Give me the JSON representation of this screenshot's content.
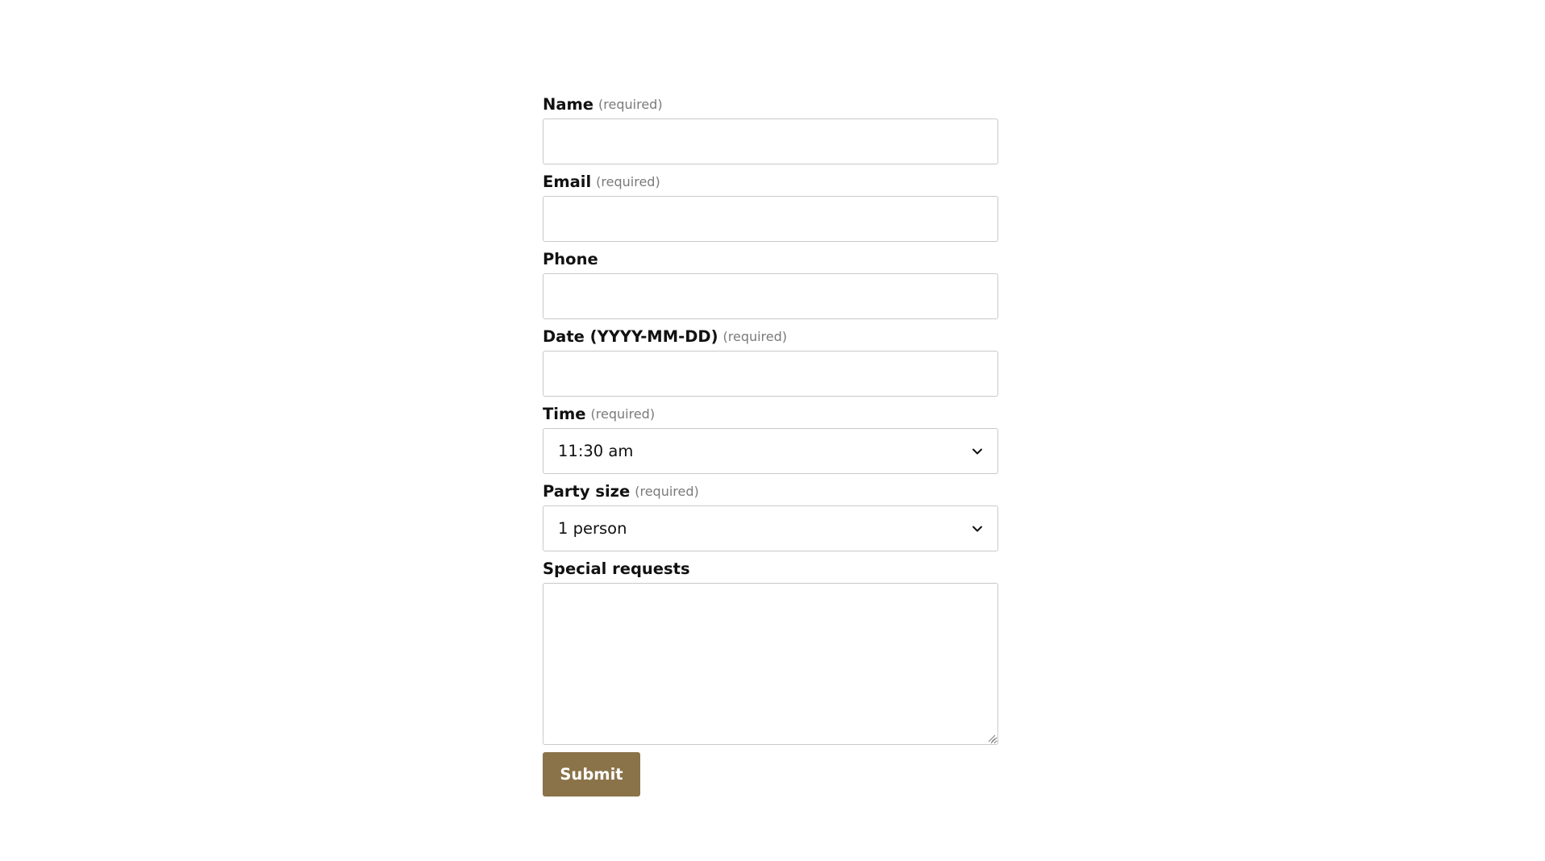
{
  "form": {
    "name": {
      "label": "Name",
      "required_text": "(required)",
      "value": ""
    },
    "email": {
      "label": "Email",
      "required_text": "(required)",
      "value": ""
    },
    "phone": {
      "label": "Phone",
      "value": ""
    },
    "date": {
      "label": "Date (YYYY-MM-DD)",
      "required_text": "(required)",
      "value": ""
    },
    "time": {
      "label": "Time",
      "required_text": "(required)",
      "selected": "11:30 am"
    },
    "party_size": {
      "label": "Party size",
      "required_text": "(required)",
      "selected": "1 person"
    },
    "special_requests": {
      "label": "Special requests",
      "value": ""
    },
    "submit_label": "Submit"
  },
  "colors": {
    "button_bg": "#8a7349",
    "button_text": "#ffffff",
    "border": "#c9c9c9",
    "required_text": "#7a7a7a"
  },
  "icons": {
    "select_arrow": "chevron-down-icon",
    "textarea_resize": "resize-grip-icon"
  }
}
